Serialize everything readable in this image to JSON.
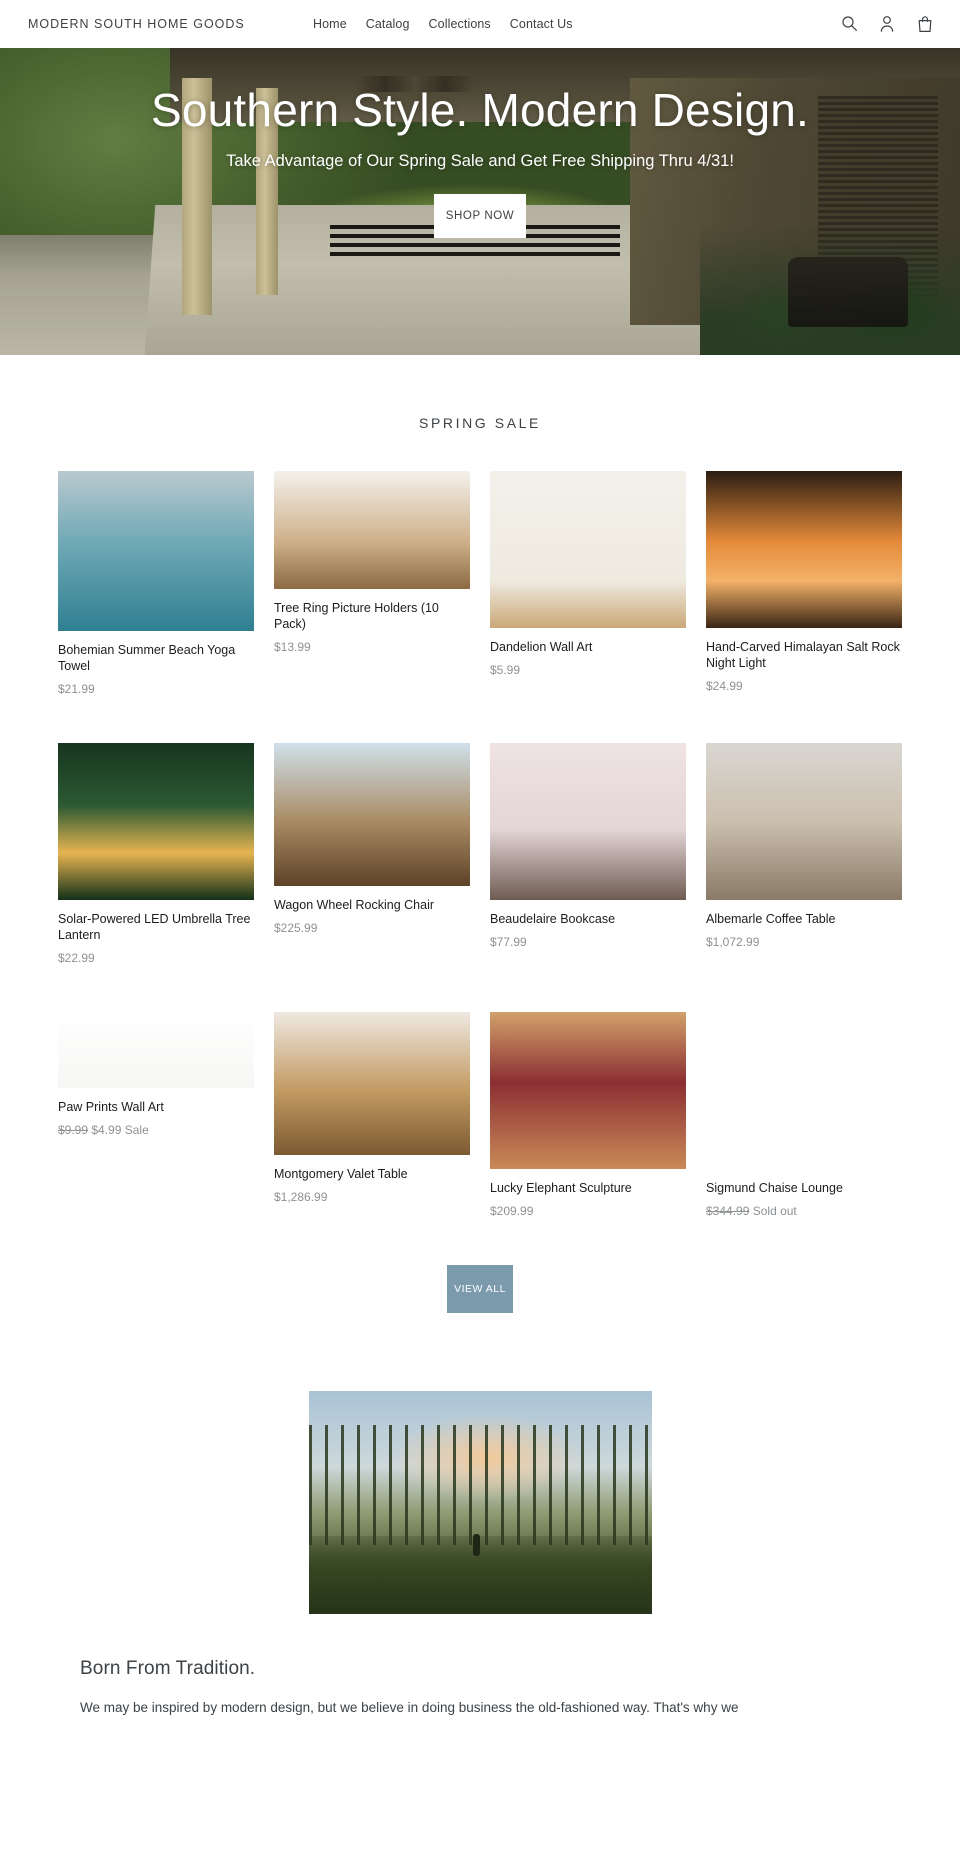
{
  "header": {
    "brand": "MODERN SOUTH HOME GOODS",
    "nav": [
      {
        "label": "Home"
      },
      {
        "label": "Catalog"
      },
      {
        "label": "Collections"
      },
      {
        "label": "Contact Us"
      }
    ],
    "icons": {
      "search": "search-icon",
      "account": "account-icon",
      "cart": "cart-icon"
    }
  },
  "hero": {
    "title": "Southern Style. Modern Design.",
    "subtitle": "Take Advantage of Our Spring Sale and Get Free Shipping Thru 4/31!",
    "cta": "SHOP NOW"
  },
  "collection": {
    "title": "SPRING SALE",
    "view_all": "VIEW ALL",
    "products": [
      {
        "title": "Bohemian Summer Beach Yoga Towel",
        "price": "$21.99",
        "media_height": 160
      },
      {
        "title": "Tree Ring Picture Holders (10 Pack)",
        "price": "$13.99",
        "media_height": 118
      },
      {
        "title": "Dandelion Wall Art",
        "price": "$5.99",
        "media_height": 157
      },
      {
        "title": "Hand-Carved Himalayan Salt Rock Night Light",
        "price": "$24.99",
        "media_height": 157
      },
      {
        "title": "Solar-Powered LED Umbrella Tree Lantern",
        "price": "$22.99",
        "media_height": 157
      },
      {
        "title": "Wagon Wheel Rocking Chair",
        "price": "$225.99",
        "media_height": 143
      },
      {
        "title": "Beaudelaire Bookcase",
        "price": "$77.99",
        "media_height": 157
      },
      {
        "title": "Albemarle Coffee Table",
        "price": "$1,072.99",
        "media_height": 157
      },
      {
        "title": "Paw Prints Wall Art",
        "price_old": "$9.99",
        "price": "$4.99",
        "badge": "Sale",
        "media_height": 76
      },
      {
        "title": "Montgomery Valet Table",
        "price": "$1,286.99",
        "media_height": 143
      },
      {
        "title": "Lucky Elephant Sculpture",
        "price": "$209.99",
        "media_height": 157
      },
      {
        "title": "Sigmund Chaise Lounge",
        "price_old": "$344.99",
        "badge": "Sold out",
        "media_height": 157
      }
    ]
  },
  "story": {
    "heading": "Born From Tradition.",
    "body": "We may be inspired by modern design, but we believe in doing business the old-fashioned way.  That's why we"
  },
  "colors": {
    "accent": "#7b9aab",
    "text": "#3d4246",
    "muted": "#8d9194"
  }
}
